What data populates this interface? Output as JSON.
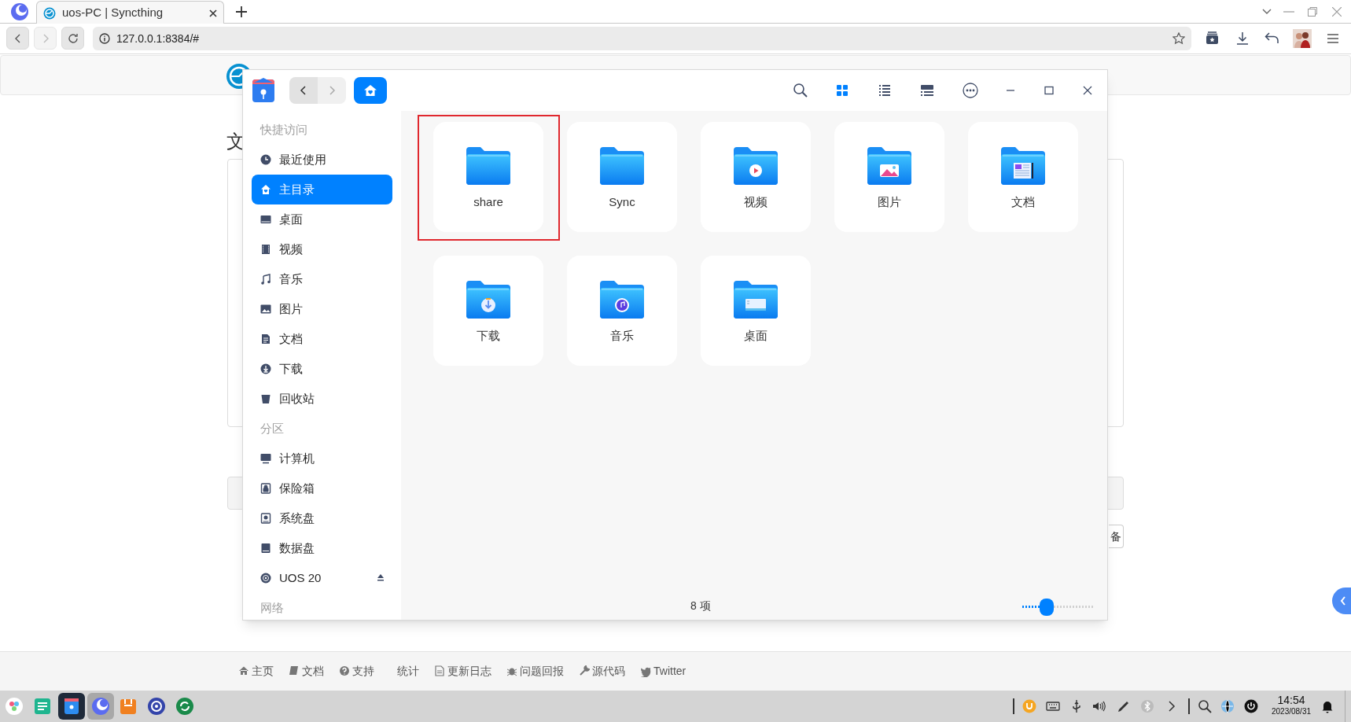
{
  "browser": {
    "tab": {
      "title": "uos-PC | Syncthing"
    },
    "address": "127.0.0.1:8384/#",
    "nav": [
      {
        "disabled": false
      },
      {
        "disabled": true
      }
    ]
  },
  "page": {
    "heading": "文",
    "button": "备",
    "footer_links": [
      "主页",
      "文档",
      "支持",
      "统计",
      "更新日志",
      "问题回报",
      "源代码",
      "Twitter"
    ]
  },
  "file_manager": {
    "nav": [
      {
        "disabled": false
      },
      {
        "disabled": true
      }
    ],
    "view_modes": [
      {
        "selected": true
      },
      {
        "selected": false
      },
      {
        "selected": false
      }
    ],
    "sidebar": [
      {
        "kind": "heading",
        "label": "快捷访问"
      },
      {
        "kind": "item",
        "label": "最近使用",
        "selected": false
      },
      {
        "kind": "item",
        "label": "主目录",
        "selected": true
      },
      {
        "kind": "item",
        "label": "桌面",
        "selected": false
      },
      {
        "kind": "item",
        "label": "视频",
        "selected": false
      },
      {
        "kind": "item",
        "label": "音乐",
        "selected": false
      },
      {
        "kind": "item",
        "label": "图片",
        "selected": false
      },
      {
        "kind": "item",
        "label": "文档",
        "selected": false
      },
      {
        "kind": "item",
        "label": "下载",
        "selected": false
      },
      {
        "kind": "item",
        "label": "回收站",
        "selected": false
      },
      {
        "kind": "heading",
        "label": "分区"
      },
      {
        "kind": "item",
        "label": "计算机",
        "selected": false
      },
      {
        "kind": "item",
        "label": "保险箱",
        "selected": false
      },
      {
        "kind": "item",
        "label": "系统盘",
        "selected": false
      },
      {
        "kind": "item",
        "label": "数据盘",
        "selected": false
      },
      {
        "kind": "device",
        "label": "UOS 20",
        "selected": false
      },
      {
        "kind": "heading",
        "label": "网络"
      }
    ],
    "files": [
      {
        "name": "share",
        "selected": true
      },
      {
        "name": "Sync",
        "selected": false
      },
      {
        "name": "视频",
        "selected": false
      },
      {
        "name": "图片",
        "selected": false
      },
      {
        "name": "文档",
        "selected": false
      },
      {
        "name": "下载",
        "selected": false
      },
      {
        "name": "音乐",
        "selected": false
      },
      {
        "name": "桌面",
        "selected": false
      }
    ],
    "item_count": "8 项",
    "zoom": {
      "level": 0.25
    }
  },
  "taskbar": {
    "time": "14:54",
    "date": "2023/08/31"
  }
}
